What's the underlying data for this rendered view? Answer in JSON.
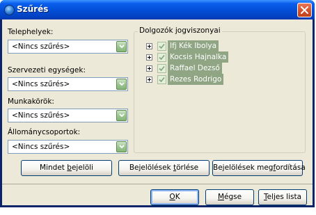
{
  "window": {
    "title": "Szűrés",
    "close_glyph": "✕"
  },
  "filters": {
    "sites_label": "Telephelyek:",
    "sites_value": "<Nincs szűrés>",
    "units_label": "Szervezeti egységek:",
    "units_value": "<Nincs szűrés>",
    "jobs_label": "Munkakörök:",
    "jobs_value": "<Nincs szűrés>",
    "positions_label": "Állománycsoportok:",
    "positions_value": "<Nincs szűrés>"
  },
  "employees": {
    "group_title": "Dolgozók jogviszonyai",
    "items": [
      {
        "label": "Ifj Kék Ibolya",
        "checked": true
      },
      {
        "label": "Kocsis Hajnalka",
        "checked": true
      },
      {
        "label": "Raffael Dezső",
        "checked": true
      },
      {
        "label": "Rezes Rodrigo",
        "checked": true
      }
    ]
  },
  "buttons": {
    "select_all": {
      "pre": "Mindet ",
      "u": "b",
      "post": "ejelöli"
    },
    "clear": {
      "pre": "Bejelölések ",
      "u": "t",
      "post": "örlése"
    },
    "invert": {
      "pre": "Bejelölések meg",
      "u": "f",
      "post": "ordítása"
    },
    "ok": {
      "pre": "",
      "u": "O",
      "post": "K"
    },
    "cancel": {
      "pre": "",
      "u": "M",
      "post": "égse"
    },
    "full_list": {
      "pre": "",
      "u": "T",
      "post": "eljes lista"
    }
  },
  "icons": {
    "window_icon": "app-globe-icon",
    "dropdown": "chevron-down-icon",
    "checkbox": "checkmark-icon",
    "expander": "plus-expander-icon"
  },
  "colors": {
    "titlebar": "#0450D8",
    "dialog_bg": "#ECE9D8",
    "selection": "#8FA584",
    "dropdown_button": "#9CC490"
  }
}
